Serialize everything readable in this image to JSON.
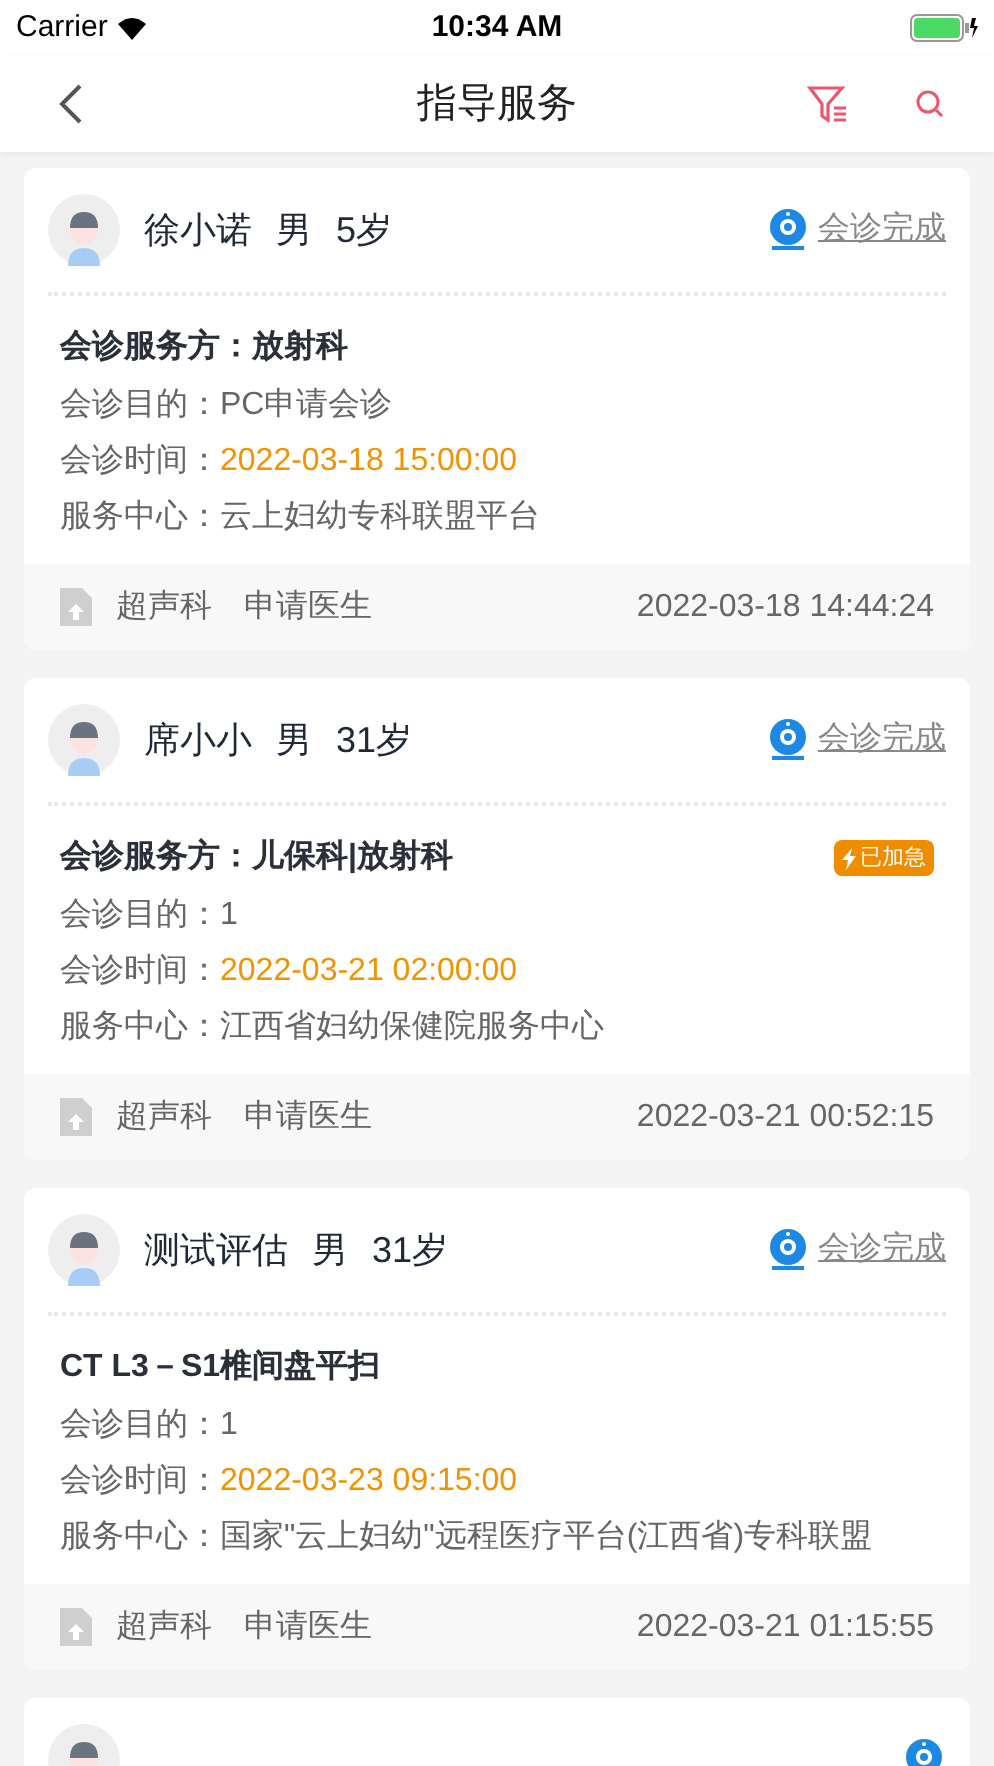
{
  "status_bar": {
    "carrier": "Carrier",
    "time": "10:34 AM"
  },
  "nav": {
    "title": "指导服务"
  },
  "cards": [
    {
      "name": "徐小诺",
      "gender": "男",
      "age": "5岁",
      "status": "会诊完成",
      "title": "会诊服务方：放射科",
      "urgent": false,
      "fields": [
        {
          "label": "会诊目的：",
          "value": "PC申请会诊",
          "highlight": false
        },
        {
          "label": "会诊时间：",
          "value": "2022-03-18 15:00:00",
          "highlight": true
        },
        {
          "label": "服务中心：",
          "value": "云上妇幼专科联盟平台",
          "highlight": false
        }
      ],
      "department": "超声科",
      "doctor": "申请医生",
      "datetime": "2022-03-18 14:44:24"
    },
    {
      "name": "席小小",
      "gender": "男",
      "age": "31岁",
      "status": "会诊完成",
      "title": "会诊服务方：儿保科|放射科",
      "urgent": true,
      "urgent_label": "已加急",
      "fields": [
        {
          "label": "会诊目的：",
          "value": "1",
          "highlight": false
        },
        {
          "label": "会诊时间：",
          "value": "2022-03-21 02:00:00",
          "highlight": true
        },
        {
          "label": "服务中心：",
          "value": "江西省妇幼保健院服务中心",
          "highlight": false
        }
      ],
      "department": "超声科",
      "doctor": "申请医生",
      "datetime": "2022-03-21 00:52:15"
    },
    {
      "name": "测试评估",
      "gender": "男",
      "age": "31岁",
      "status": "会诊完成",
      "title": "CT  L3－S1椎间盘平扫",
      "urgent": false,
      "fields": [
        {
          "label": "会诊目的：",
          "value": "1",
          "highlight": false
        },
        {
          "label": "会诊时间：",
          "value": "2022-03-23 09:15:00",
          "highlight": true
        },
        {
          "label": "服务中心：",
          "value": "国家\"云上妇幼\"远程医疗平台(江西省)专科联盟",
          "highlight": false
        }
      ],
      "department": "超声科",
      "doctor": "申请医生",
      "datetime": "2022-03-21 01:15:55"
    },
    {
      "partial": true
    }
  ]
}
